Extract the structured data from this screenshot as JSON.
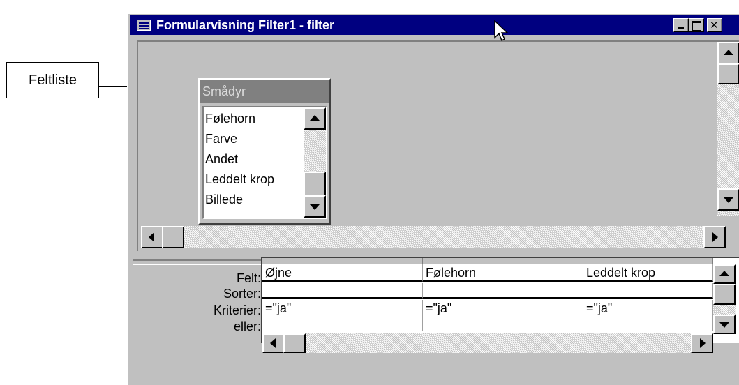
{
  "callout": {
    "label": "Feltliste"
  },
  "window": {
    "title": "Formularvisning Filter1 - filter",
    "buttons": {
      "minimize": "minimize",
      "maximize": "maximize",
      "close": "close"
    }
  },
  "field_list": {
    "title": "Smådyr",
    "items": [
      "Følehorn",
      "Farve",
      "Andet",
      "Leddelt krop",
      "Billede"
    ]
  },
  "grid": {
    "row_labels": [
      "Felt:",
      "Sorter:",
      "Kriterier:",
      "eller:"
    ],
    "columns": [
      {
        "field": "Øjne",
        "sort": "",
        "criteria": "=\"ja\"",
        "or": ""
      },
      {
        "field": "Følehorn",
        "sort": "",
        "criteria": "=\"ja\"",
        "or": ""
      },
      {
        "field": "Leddelt krop",
        "sort": "",
        "criteria": "=\"ja\"",
        "or": ""
      }
    ]
  },
  "colors": {
    "titlebar": "#000080",
    "face": "#c0c0c0",
    "fieldlist_title": "#808080"
  }
}
